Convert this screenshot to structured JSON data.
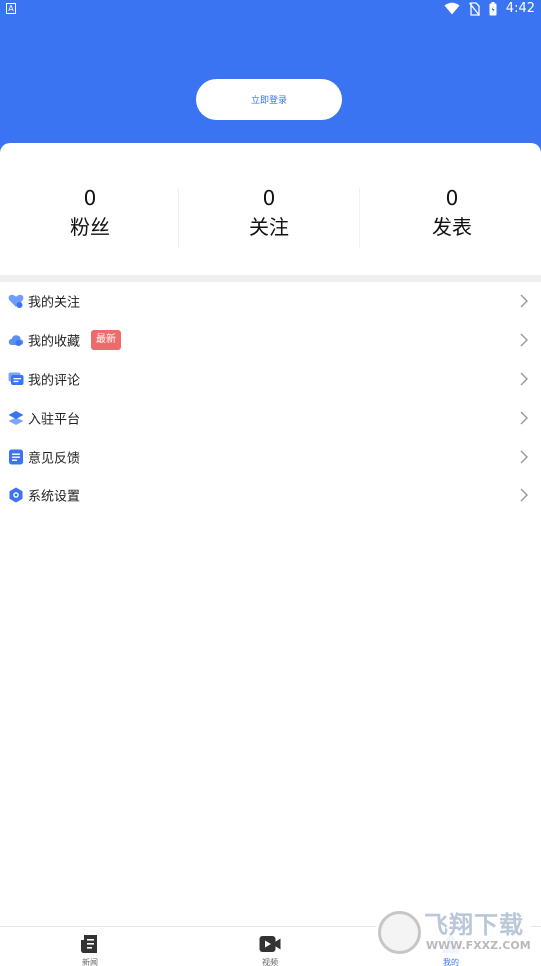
{
  "status_bar": {
    "left_indicator": "A",
    "time": "4:42"
  },
  "header": {
    "login_label": "立即登录"
  },
  "stats": [
    {
      "value": "0",
      "label": "粉丝"
    },
    {
      "value": "0",
      "label": "关注"
    },
    {
      "value": "0",
      "label": "发表"
    }
  ],
  "menu": {
    "items": [
      {
        "label": "我的关注",
        "icon": "heart-icon"
      },
      {
        "label": "我的收藏",
        "icon": "cloud-icon",
        "badge": "最新"
      },
      {
        "label": "我的评论",
        "icon": "comment-icon"
      },
      {
        "label": "入驻平台",
        "icon": "layers-icon"
      },
      {
        "label": "意见反馈",
        "icon": "document-icon"
      },
      {
        "label": "系统设置",
        "icon": "settings-icon"
      }
    ]
  },
  "tabbar": {
    "tabs": [
      {
        "label": "新闻",
        "icon": "news-icon",
        "active": false
      },
      {
        "label": "视频",
        "icon": "video-icon",
        "active": false
      },
      {
        "label": "我的",
        "icon": "profile-icon",
        "active": true
      }
    ]
  },
  "watermark": {
    "text": "飞翔下载",
    "url": "WWW.FXXZ.COM"
  },
  "colors": {
    "primary": "#3b74f2",
    "badge": "#ee6b6b",
    "icon_blue": "#4f8af5",
    "divider": "#efefef"
  }
}
